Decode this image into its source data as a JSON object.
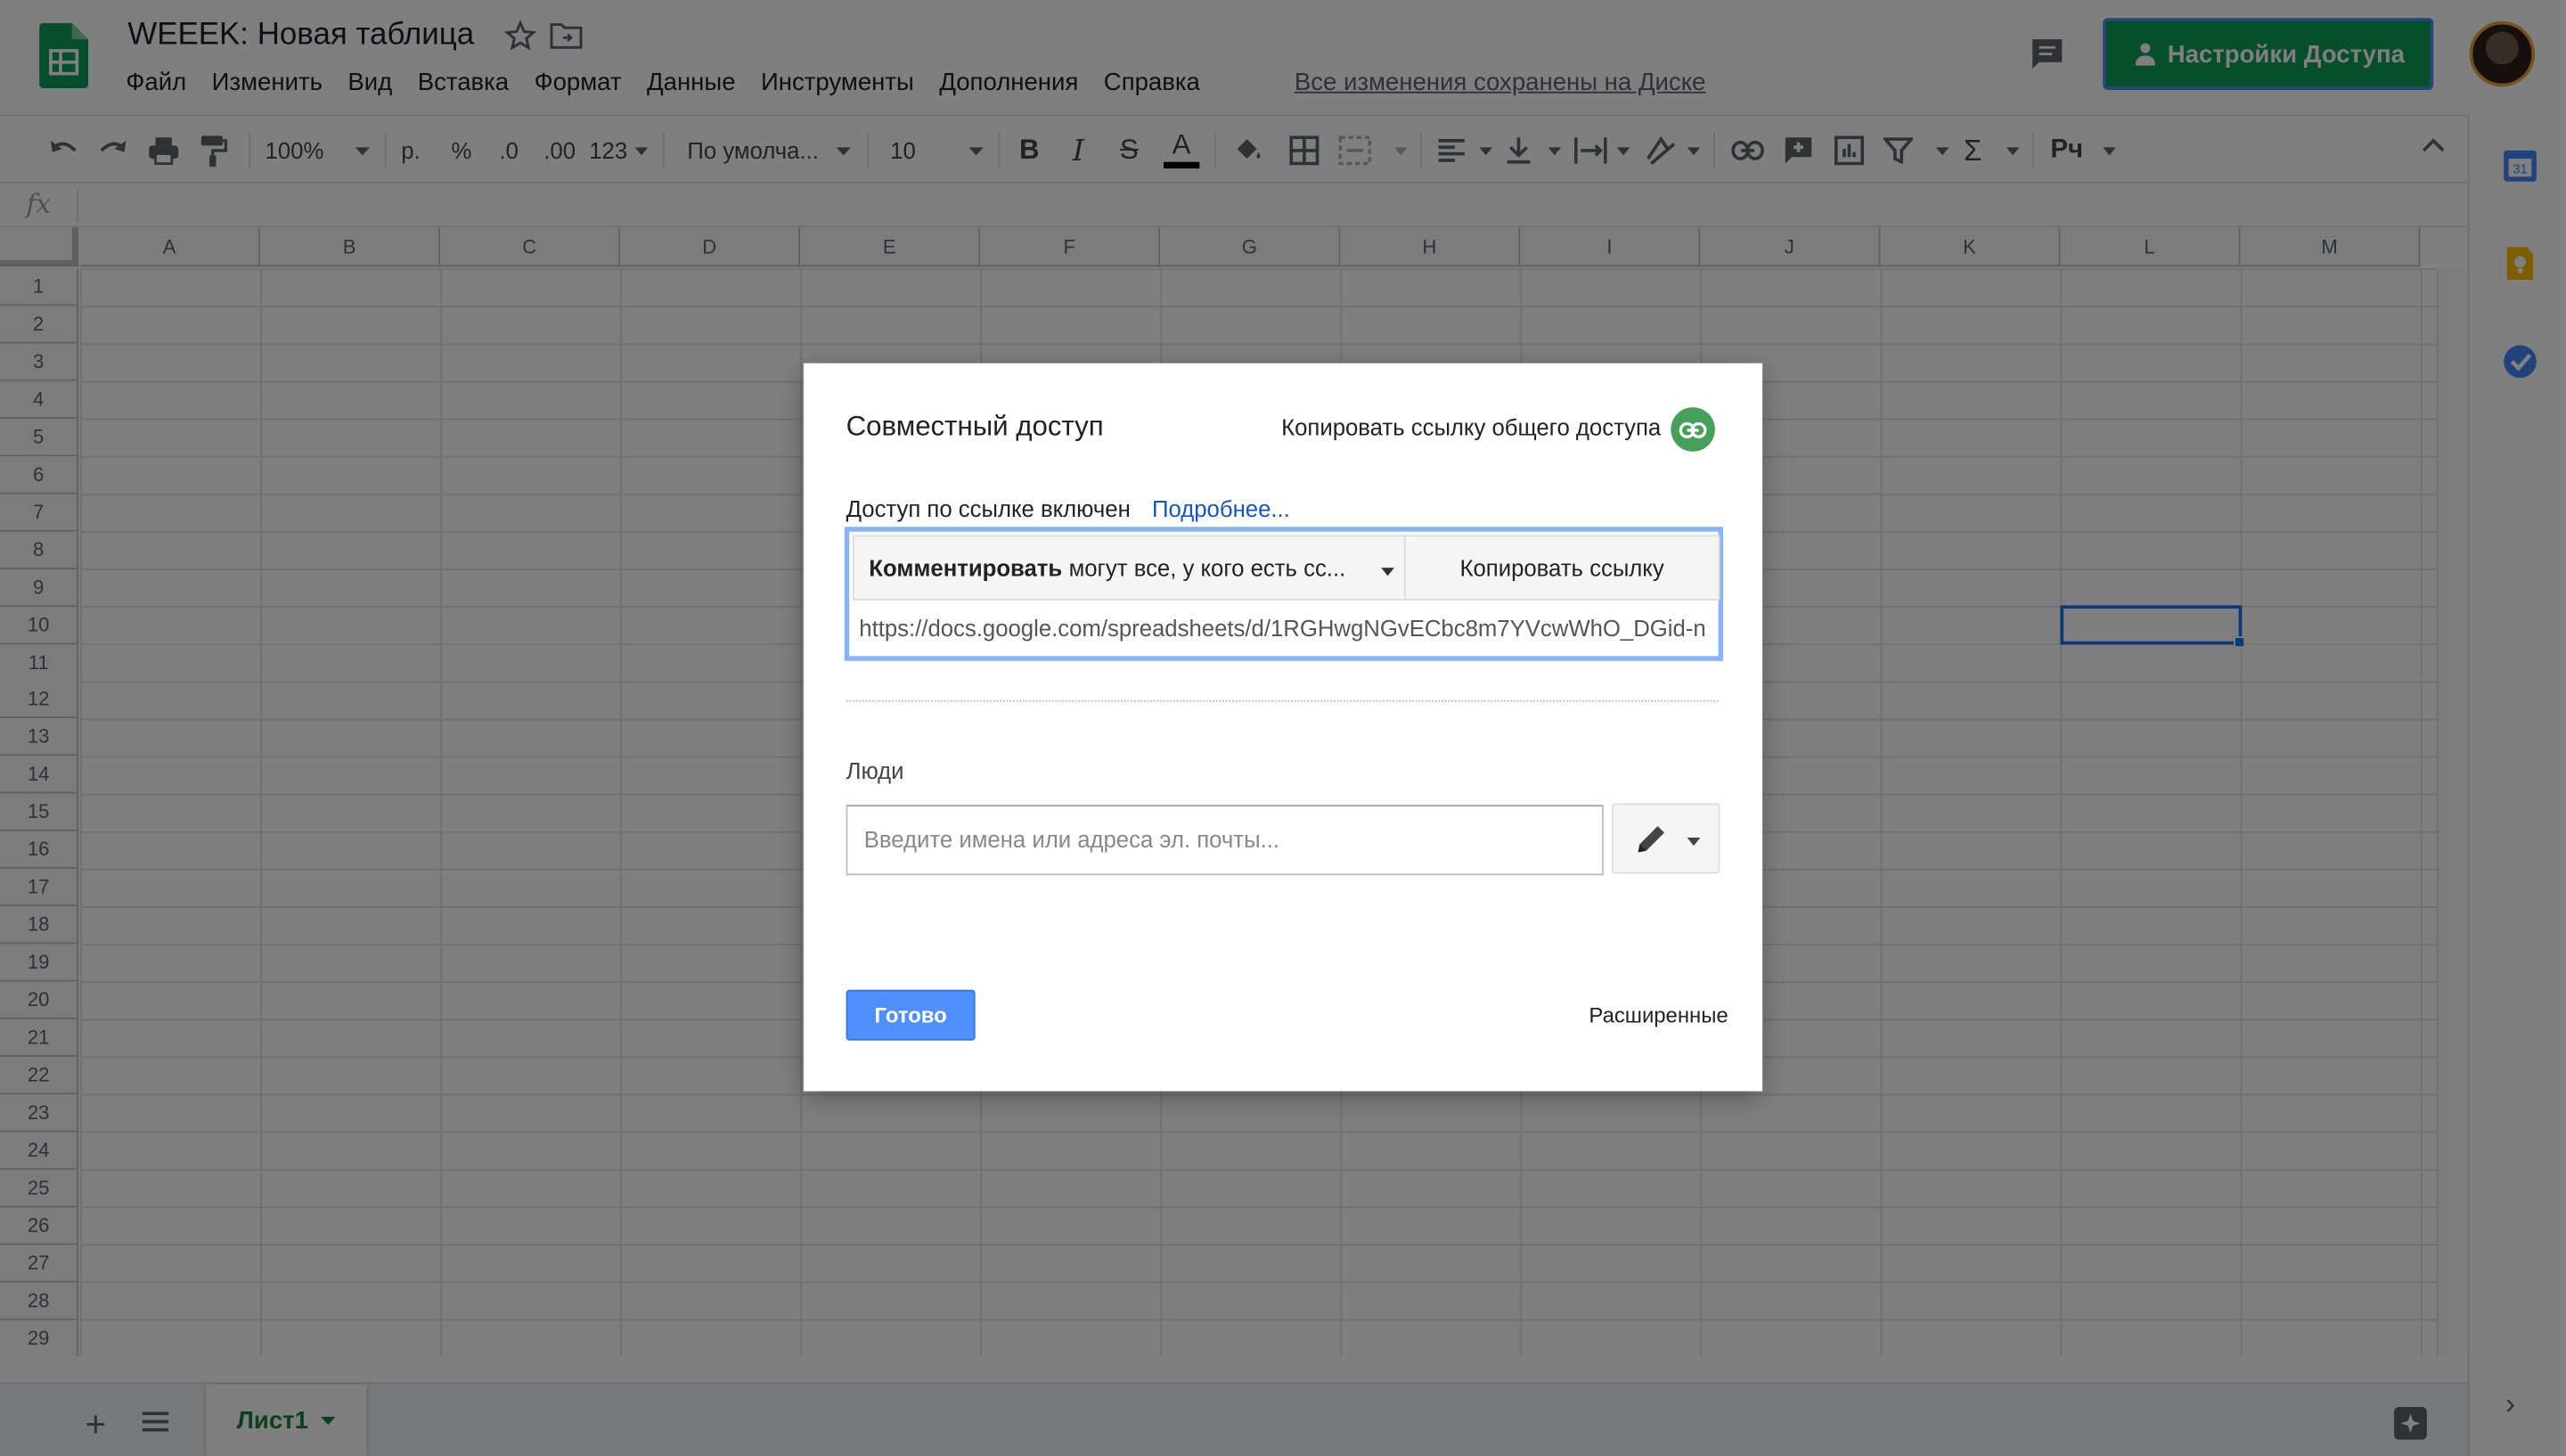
{
  "header": {
    "doc_title": "WEEEK: Новая таблица",
    "menu": [
      "Файл",
      "Изменить",
      "Вид",
      "Вставка",
      "Формат",
      "Данные",
      "Инструменты",
      "Дополнения",
      "Справка"
    ],
    "saved_status": "Все изменения сохранены на Диске",
    "share_button_label": "Настройки Доступа",
    "accent_color": "#0f9d58"
  },
  "toolbar": {
    "zoom": "100%",
    "currency": "р.",
    "percent": "%",
    "decrease_decimals": ".0",
    "increase_decimals": ".00",
    "more_formats": "123",
    "font": "По умолча...",
    "font_size": "10",
    "bold": "B",
    "italic": "I",
    "strikethrough": "S",
    "text_color": "A",
    "sigma": "Σ",
    "input_tools": "Рч"
  },
  "formula_bar": {
    "fx": "fx"
  },
  "grid": {
    "columns": [
      "A",
      "B",
      "C",
      "D",
      "E",
      "F",
      "G",
      "H",
      "I",
      "J",
      "K",
      "L",
      "M"
    ],
    "rows": [
      "1",
      "2",
      "3",
      "4",
      "5",
      "6",
      "7",
      "8",
      "9",
      "10",
      "11",
      "12",
      "13",
      "14",
      "15",
      "16",
      "17",
      "18",
      "19",
      "20",
      "21",
      "22",
      "23",
      "24",
      "25",
      "26",
      "27",
      "28",
      "29"
    ],
    "selected_cell": "L10"
  },
  "sheets": {
    "add": "+",
    "tabs": [
      "Лист1"
    ]
  },
  "dialog": {
    "title": "Совместный доступ",
    "copy_share_link": "Копировать ссылку общего доступа",
    "link_status": "Доступ по ссылке включен",
    "learn_more": "Подробнее...",
    "permission_bold": "Комментировать",
    "permission_rest": "могут все, у кого есть сс...",
    "copy_link_button": "Копировать ссылку",
    "url": "https://docs.google.com/spreadsheets/d/1RGHwgNGvECbc8m7YVcwWhO_DGid-n",
    "people_label": "Люди",
    "people_placeholder": "Введите имена или адреса эл. почты...",
    "done_button": "Готово",
    "advanced_link": "Расширенные"
  }
}
